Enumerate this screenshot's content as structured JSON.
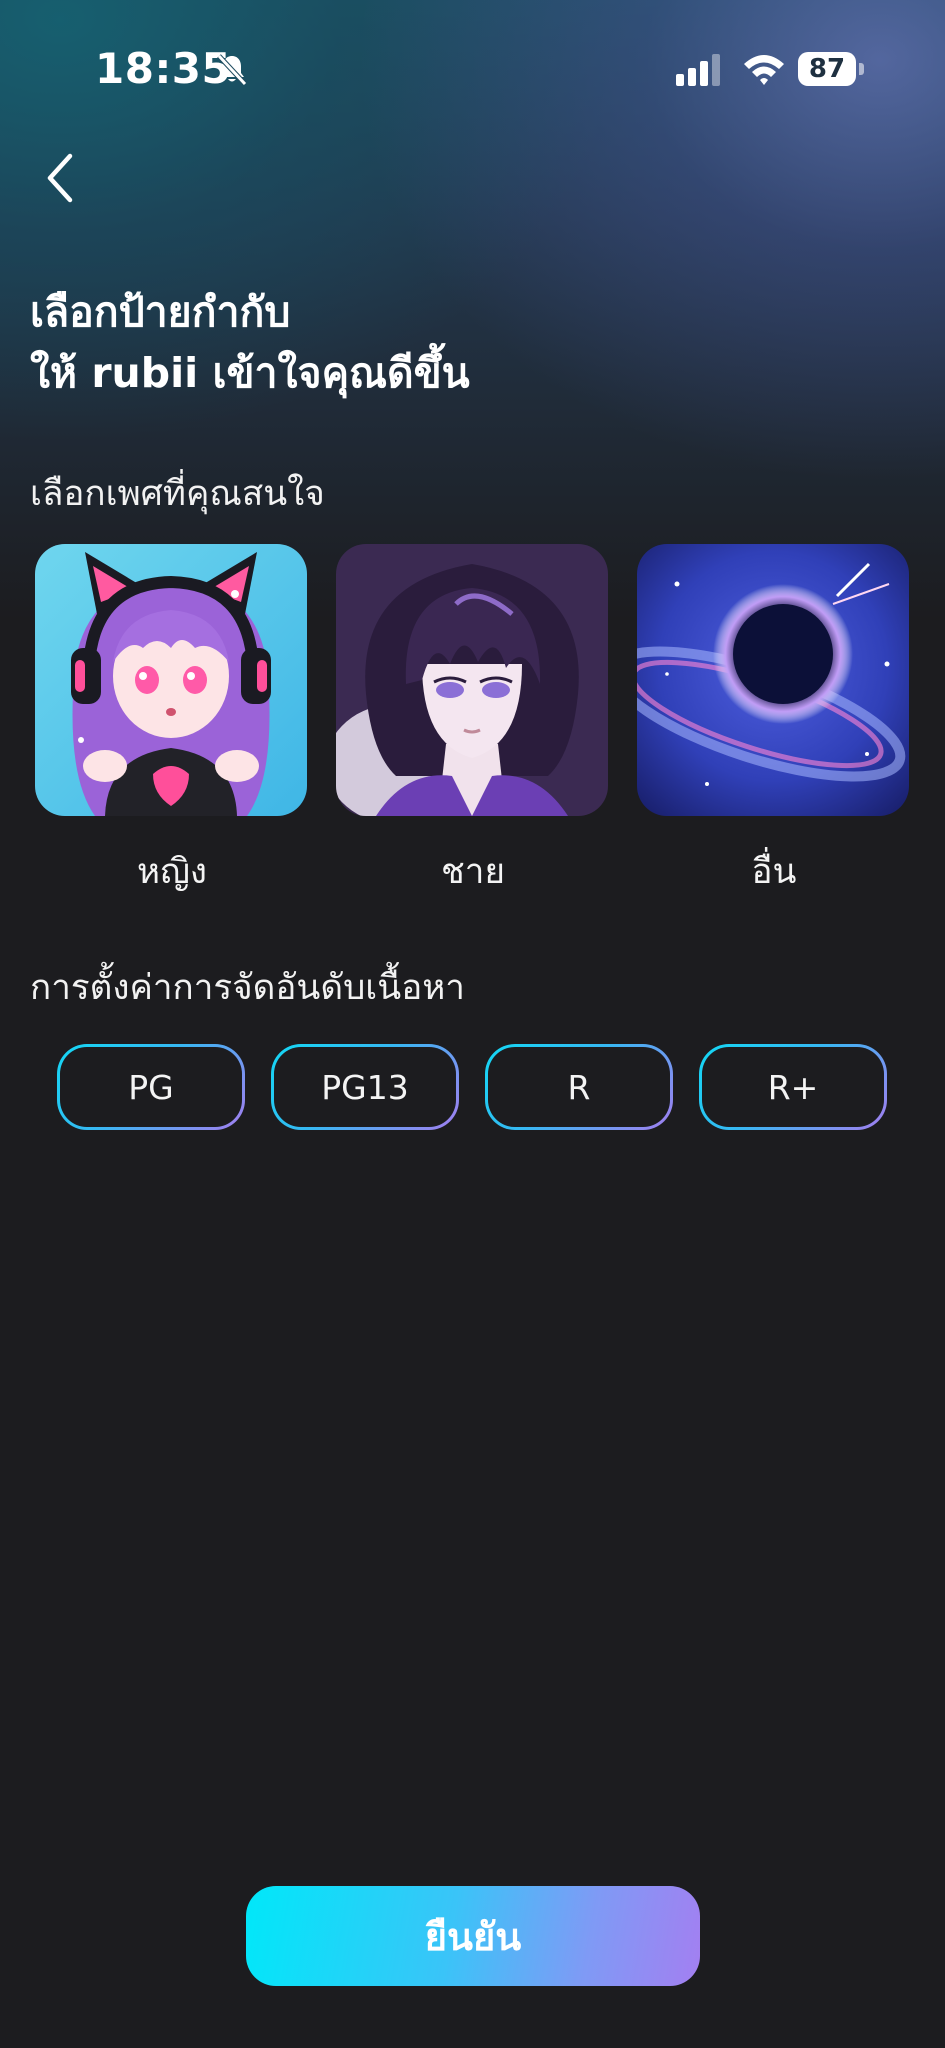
{
  "status_bar": {
    "time": "18:35",
    "battery": "87",
    "icons": [
      "bell-slash-icon",
      "cellular-signal-icon",
      "wifi-icon",
      "battery-icon"
    ]
  },
  "nav": {
    "back_icon": "chevron-left-icon"
  },
  "title": {
    "line1": "เลือกป้ายกำกับ",
    "line2": "ให้ rubii เข้าใจคุณดีขึ้น"
  },
  "gender_section": {
    "label": "เลือกเพศที่คุณสนใจ",
    "options": [
      {
        "label": "หญิง"
      },
      {
        "label": "ชาย"
      },
      {
        "label": "อื่น"
      }
    ]
  },
  "rating_section": {
    "label": "การตั้งค่าการจัดอันดับเนื้อหา",
    "options": [
      {
        "label": "PG"
      },
      {
        "label": "PG13"
      },
      {
        "label": "R"
      },
      {
        "label": "R+"
      }
    ]
  },
  "confirm_button": {
    "label": "ยืนยัน"
  },
  "colors": {
    "background": "#1c1c1f",
    "accent_cyan": "#00e8f9",
    "accent_purple": "#a37ff1"
  }
}
